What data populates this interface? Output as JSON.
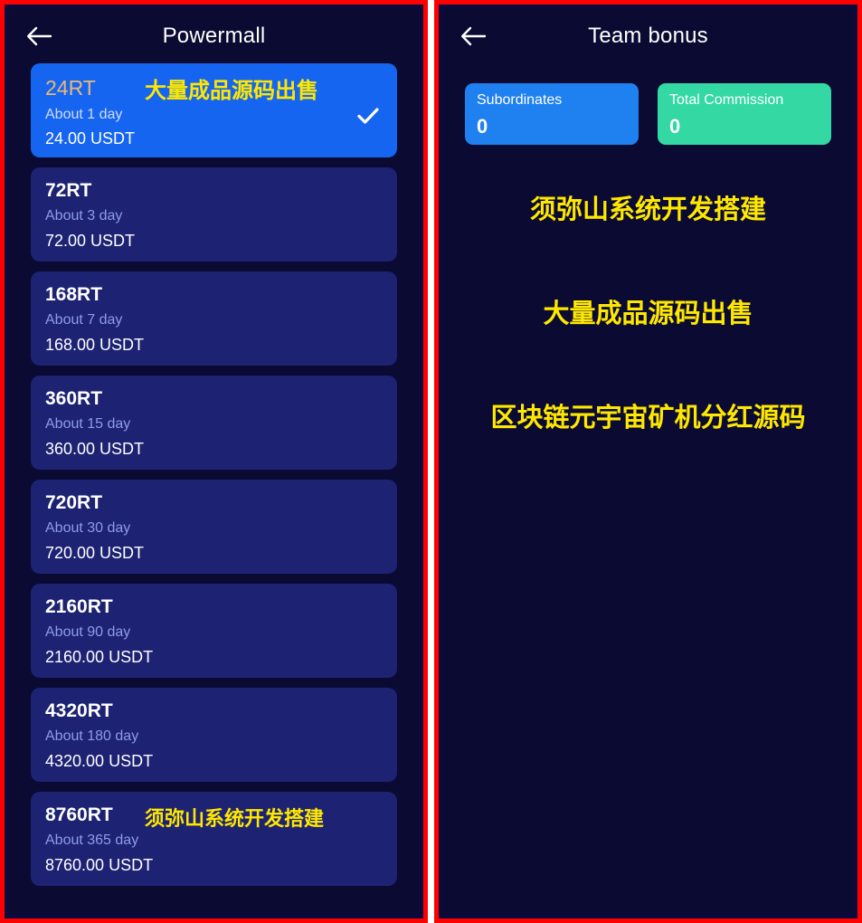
{
  "theme": {
    "page_bg": "#ffffff",
    "panel_border": "#ff0000",
    "panel_bg": "#0a0a32",
    "card_bg": "#1d2273",
    "card_selected_bg": "#1665f0",
    "accent_gold": "#e9b877",
    "watermark_yellow": "#ffe800",
    "stat_blue": "#1f80ef",
    "stat_green": "#33d8a2",
    "subtitle_blue": "#8f9ce8"
  },
  "left_panel": {
    "header": {
      "back_icon": "arrow-left-icon",
      "title": "Powermall"
    },
    "plans": [
      {
        "name": "24RT",
        "duration": "About 1 day",
        "price": "24.00 USDT",
        "selected": true,
        "check_icon": "check-icon",
        "watermark": "大量成品源码出售"
      },
      {
        "name": "72RT",
        "duration": "About 3 day",
        "price": "72.00 USDT",
        "selected": false,
        "watermark": ""
      },
      {
        "name": "168RT",
        "duration": "About 7 day",
        "price": "168.00 USDT",
        "selected": false,
        "watermark": ""
      },
      {
        "name": "360RT",
        "duration": "About 15 day",
        "price": "360.00 USDT",
        "selected": false,
        "watermark": ""
      },
      {
        "name": "720RT",
        "duration": "About 30 day",
        "price": "720.00 USDT",
        "selected": false,
        "watermark": ""
      },
      {
        "name": "2160RT",
        "duration": "About 90 day",
        "price": "2160.00 USDT",
        "selected": false,
        "watermark": ""
      },
      {
        "name": "4320RT",
        "duration": "About 180 day",
        "price": "4320.00 USDT",
        "selected": false,
        "watermark": ""
      },
      {
        "name": "8760RT",
        "duration": "About 365 day",
        "price": "8760.00 USDT",
        "selected": false,
        "watermark": "须弥山系统开发搭建"
      }
    ]
  },
  "right_panel": {
    "header": {
      "back_icon": "arrow-left-icon",
      "title": "Team bonus"
    },
    "stats": [
      {
        "label": "Subordinates",
        "value": "0",
        "color": "blue"
      },
      {
        "label": "Total Commission",
        "value": "0",
        "color": "green"
      }
    ],
    "promo_lines": [
      "须弥山系统开发搭建",
      "大量成品源码出售",
      "区块链元宇宙矿机分红源码"
    ]
  }
}
